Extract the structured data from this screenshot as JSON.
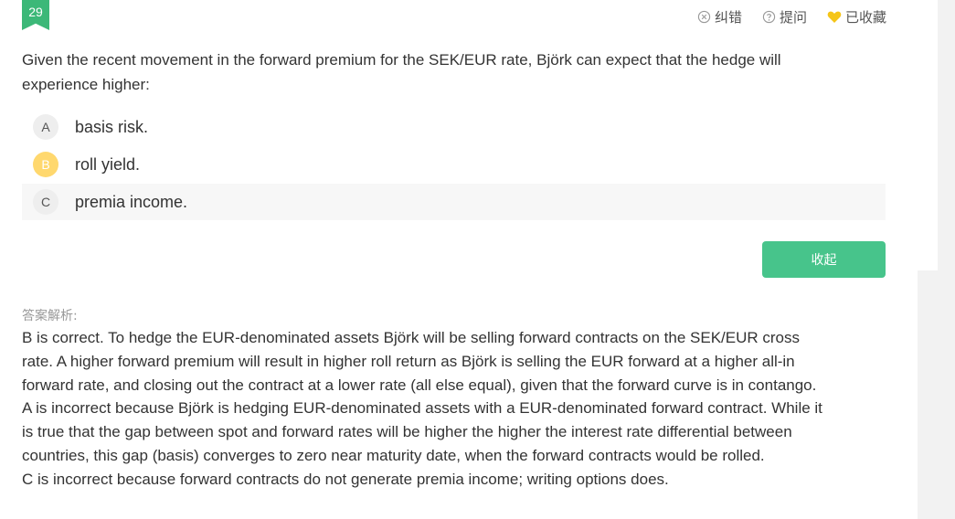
{
  "question_number": "29",
  "toolbar": {
    "report_label": "纠错",
    "ask_label": "提问",
    "favorite_label": "已收藏"
  },
  "colors": {
    "accent_green": "#47c48b",
    "selected_badge": "#ffd86e",
    "favorite_heart": "#f5c518"
  },
  "question": {
    "text": "Given the recent movement in the forward premium for the SEK/EUR rate, Björk  can expect that the hedge will experience higher:"
  },
  "options": [
    {
      "letter": "A",
      "text": "basis risk.",
      "selected": false
    },
    {
      "letter": "B",
      "text": "roll yield.",
      "selected": true
    },
    {
      "letter": "C",
      "text": "premia income.",
      "selected": false
    }
  ],
  "collapse_button_label": "收起",
  "explanation": {
    "label": "答案解析:",
    "lines": [
      "B is correct. To hedge the EUR-denominated assets Björk will be selling forward  contracts on the SEK/EUR cross",
      "rate. A higher forward premium will result in  higher roll return as Björk is selling the EUR forward at a higher all-in",
      "forward  rate, and closing out the contract at a lower rate (all else equal), given that the  forward curve is in contango.",
      "A is incorrect because Björk is hedging EUR-denominated assets with a EUR-denominated forward contract. While it",
      "is true that the gap between spot and forward rates will be higher the higher the interest rate differential between",
      "countries, this gap (basis) converges to zero near maturity date, when the forward contracts would be rolled.",
      "C is incorrect because forward contracts do not generate premia income; writing  options does."
    ]
  }
}
